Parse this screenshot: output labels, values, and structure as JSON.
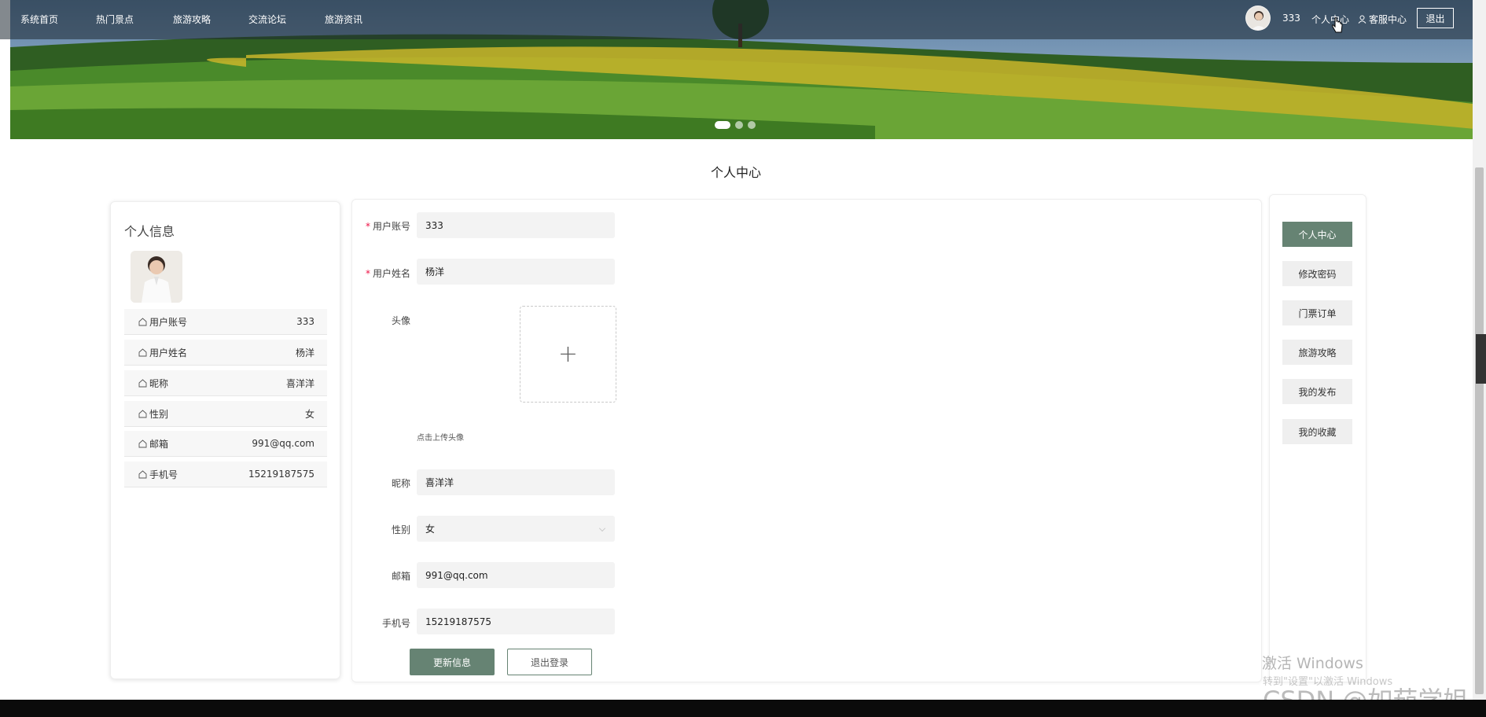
{
  "nav": {
    "items": [
      "系统首页",
      "热门景点",
      "旅游攻略",
      "交流论坛",
      "旅游资讯"
    ],
    "username": "333",
    "personal_center": "个人中心",
    "customer_service": "客服中心",
    "logout": "退出"
  },
  "banner": {
    "slide_count": 3,
    "active_slide": 1
  },
  "section_title": "个人中心",
  "profile": {
    "heading": "个人信息",
    "rows": [
      {
        "label": "用户账号",
        "value": "333"
      },
      {
        "label": "用户姓名",
        "value": "杨洋"
      },
      {
        "label": "昵称",
        "value": "喜洋洋"
      },
      {
        "label": "性别",
        "value": "女"
      },
      {
        "label": "邮箱",
        "value": "991@qq.com"
      },
      {
        "label": "手机号",
        "value": "15219187575"
      }
    ]
  },
  "form": {
    "account": {
      "label": "用户账号",
      "value": "333"
    },
    "name": {
      "label": "用户姓名",
      "value": "杨洋"
    },
    "avatar": {
      "label": "头像",
      "upload_icon": "+",
      "hint": "点击上传头像"
    },
    "nickname": {
      "label": "昵称",
      "value": "喜洋洋"
    },
    "gender": {
      "label": "性别",
      "value": "女"
    },
    "email": {
      "label": "邮箱",
      "value": "991@qq.com"
    },
    "phone": {
      "label": "手机号",
      "value": "15219187575"
    },
    "update_button": "更新信息",
    "logout_button": "退出登录"
  },
  "side_menu": [
    "个人中心",
    "修改密码",
    "门票订单",
    "旅游攻略",
    "我的发布",
    "我的收藏"
  ],
  "colors": {
    "accent": "#668373",
    "required": "#e14455"
  },
  "overlay": {
    "activate_title": "激活 Windows",
    "activate_hint": "转到\"设置\"以激活 Windows",
    "csdn": "CSDN @如茄学姐"
  }
}
